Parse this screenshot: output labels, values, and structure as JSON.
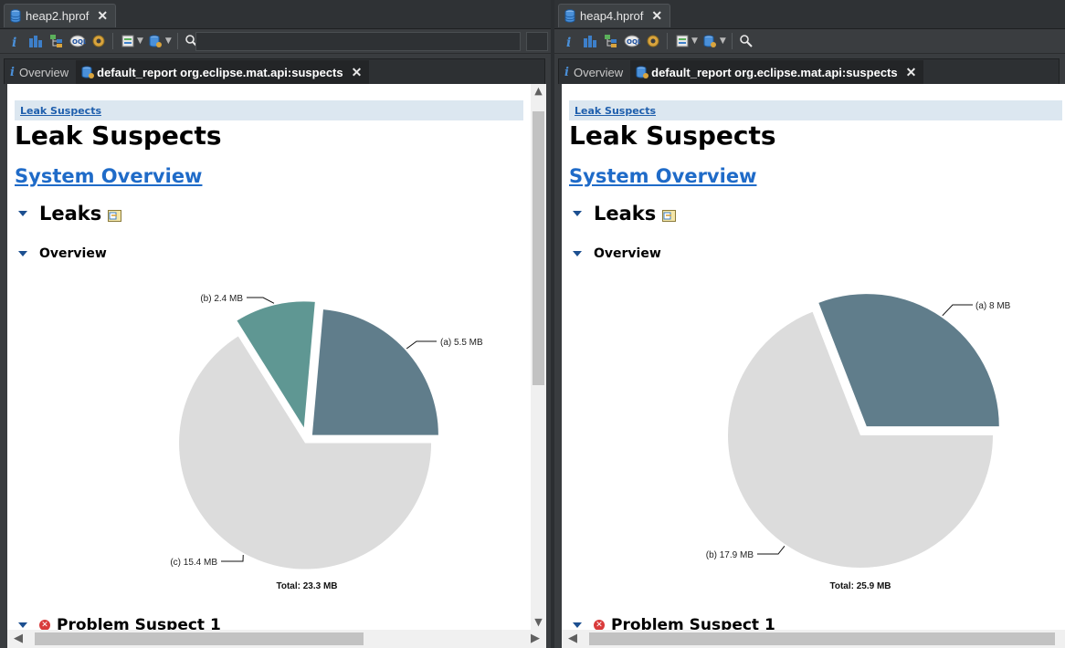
{
  "left": {
    "file_tab": "heap2.hprof",
    "view_tabs": {
      "overview": "Overview",
      "report": "default_report  org.eclipse.mat.api:suspects"
    },
    "breadcrumb": "Leak Suspects",
    "title": "Leak Suspects",
    "system_overview": "System Overview",
    "leaks_heading": "Leaks",
    "overview_heading": "Overview",
    "problem_heading": "Problem Suspect 1",
    "chart_data": {
      "type": "pie",
      "slices": [
        {
          "key": "(a)",
          "label": "(a)  5.5 MB",
          "value": 5.5,
          "color": "#607d8b"
        },
        {
          "key": "(b)",
          "label": "(b)  2.4 MB",
          "value": 2.4,
          "color": "#5f9793"
        },
        {
          "key": "(c)",
          "label": "(c)  15.4 MB",
          "value": 15.4,
          "color": "#dcdcdc"
        }
      ],
      "total_label": "Total: 23.3 MB",
      "unit": "MB"
    }
  },
  "right": {
    "file_tab": "heap4.hprof",
    "view_tabs": {
      "overview": "Overview",
      "report": "default_report  org.eclipse.mat.api:suspects"
    },
    "breadcrumb": "Leak Suspects",
    "title": "Leak Suspects",
    "system_overview": "System Overview",
    "leaks_heading": "Leaks",
    "overview_heading": "Overview",
    "problem_heading": "Problem Suspect 1",
    "chart_data": {
      "type": "pie",
      "slices": [
        {
          "key": "(a)",
          "label": "(a)  8 MB",
          "value": 8,
          "color": "#607d8b"
        },
        {
          "key": "(b)",
          "label": "(b)  17.9 MB",
          "value": 17.9,
          "color": "#dcdcdc"
        }
      ],
      "total_label": "Total: 25.9 MB",
      "unit": "MB"
    }
  },
  "icons": {
    "file_tab": "database-icon",
    "close": "close-icon",
    "toolbar": [
      "info-icon",
      "histogram-icon",
      "dominator-tree-icon",
      "oql-icon",
      "gear-icon",
      "heap-dump-overview-icon",
      "query-browser-icon",
      "search-icon"
    ],
    "leaks_note": "note-icon",
    "problem": "error-icon",
    "section_toggle": "expand-triangle-icon"
  }
}
